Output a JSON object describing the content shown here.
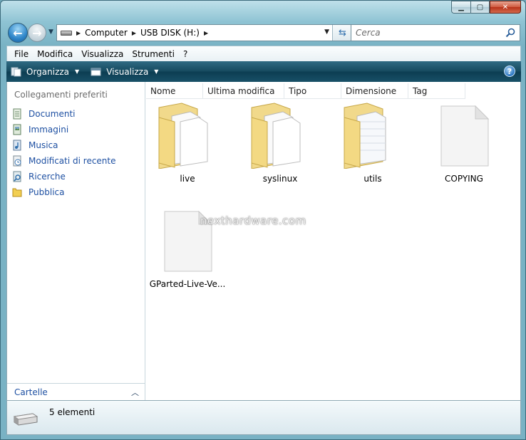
{
  "navigation": {
    "breadcrumb": [
      "Computer",
      "USB DISK (H:)"
    ],
    "search_placeholder": "Cerca"
  },
  "menu": [
    "File",
    "Modifica",
    "Visualizza",
    "Strumenti",
    "?"
  ],
  "commandbar": {
    "organize": "Organizza",
    "view": "Visualizza"
  },
  "nav_pane": {
    "heading": "Collegamenti preferiti",
    "items": [
      "Documenti",
      "Immagini",
      "Musica",
      "Modificati di recente",
      "Ricerche",
      "Pubblica"
    ],
    "folders_label": "Cartelle"
  },
  "columns": [
    "Nome",
    "Ultima modifica",
    "Tipo",
    "Dimensione",
    "Tag"
  ],
  "files": [
    {
      "name": "live",
      "type": "folder"
    },
    {
      "name": "syslinux",
      "type": "folder"
    },
    {
      "name": "utils",
      "type": "folder"
    },
    {
      "name": "COPYING",
      "type": "file"
    },
    {
      "name": "GParted-Live-Ve...",
      "type": "file"
    }
  ],
  "watermark": "nexthardware.com",
  "details": {
    "count_text": "5 elementi"
  }
}
